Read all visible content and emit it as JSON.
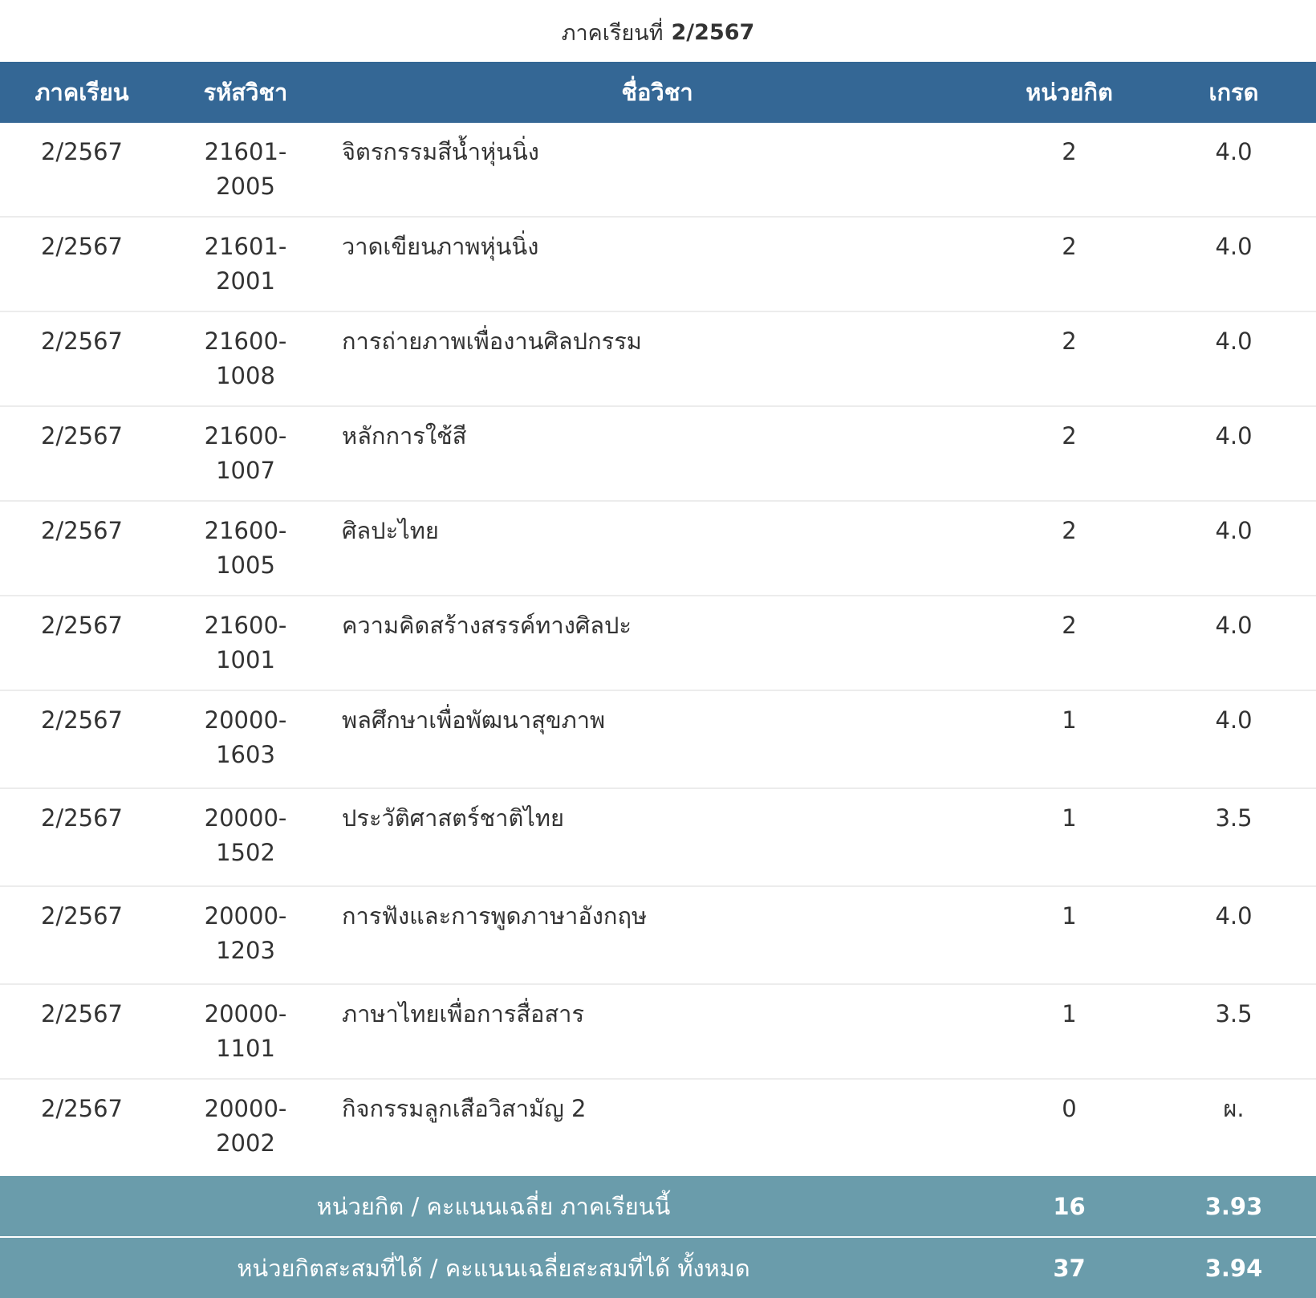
{
  "caption": {
    "prefix": "ภาคเรียนที่",
    "term": "2/2567"
  },
  "columns": {
    "term": "ภาคเรียน",
    "code": "รหัสวิชา",
    "name": "ชื่อวิชา",
    "credit": "หน่วยกิต",
    "grade": "เกรด"
  },
  "rows": [
    {
      "term": "2/2567",
      "code": "21601-2005",
      "name": "จิตรกรรมสีน้ำหุ่นนิ่ง",
      "credit": "2",
      "grade": "4.0"
    },
    {
      "term": "2/2567",
      "code": "21601-2001",
      "name": "วาดเขียนภาพหุ่นนิ่ง",
      "credit": "2",
      "grade": "4.0"
    },
    {
      "term": "2/2567",
      "code": "21600-1008",
      "name": "การถ่ายภาพเพื่องานศิลปกรรม",
      "credit": "2",
      "grade": "4.0"
    },
    {
      "term": "2/2567",
      "code": "21600-1007",
      "name": "หลักการใช้สี",
      "credit": "2",
      "grade": "4.0"
    },
    {
      "term": "2/2567",
      "code": "21600-1005",
      "name": "ศิลปะไทย",
      "credit": "2",
      "grade": "4.0"
    },
    {
      "term": "2/2567",
      "code": "21600-1001",
      "name": "ความคิดสร้างสรรค์ทางศิลปะ",
      "credit": "2",
      "grade": "4.0"
    },
    {
      "term": "2/2567",
      "code": "20000-1603",
      "name": "พลศึกษาเพื่อพัฒนาสุขภาพ",
      "credit": "1",
      "grade": "4.0"
    },
    {
      "term": "2/2567",
      "code": "20000-1502",
      "name": "ประวัติศาสตร์ชาติไทย",
      "credit": "1",
      "grade": "3.5"
    },
    {
      "term": "2/2567",
      "code": "20000-1203",
      "name": "การฟังและการพูดภาษาอังกฤษ",
      "credit": "1",
      "grade": "4.0"
    },
    {
      "term": "2/2567",
      "code": "20000-1101",
      "name": "ภาษาไทยเพื่อการสื่อสาร",
      "credit": "1",
      "grade": "3.5"
    },
    {
      "term": "2/2567",
      "code": "20000-2002",
      "name": "กิจกรรมลูกเสือวิสามัญ 2",
      "credit": "0",
      "grade": "ผ."
    }
  ],
  "summary": {
    "term_label": "หน่วยกิต / คะแนนเฉลี่ย ภาคเรียนนี้",
    "term_credits": "16",
    "term_gpa": "3.93",
    "total_label": "หน่วยกิตสะสมที่ได้ / คะแนนเฉลี่ยสะสมที่ได้ ทั้งหมด",
    "total_credits": "37",
    "total_gpa": "3.94"
  },
  "colors": {
    "header_bg": "#346795",
    "summary_bg": "#6a9cab",
    "row_divider": "#ececec"
  }
}
